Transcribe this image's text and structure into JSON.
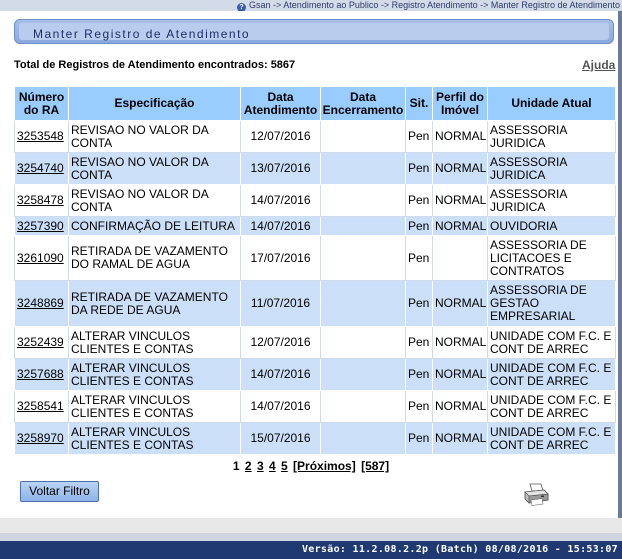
{
  "breadcrumb": "Gsan -> Atendimento ao Publico -> Registro Atendimento -> Manter Registro de Atendimento",
  "page_title": "Manter Registro de Atendimento",
  "total_label": "Total de Registros de Atendimento encontrados: 5867",
  "help_label": "Ajuda",
  "table": {
    "headers": {
      "numero": "Número do RA",
      "especificacao": "Especificação",
      "data_atendimento": "Data Atendimento",
      "data_encerramento": "Data Encerramento",
      "sit": "Sit.",
      "perfil": "Perfil do Imóvel",
      "unidade": "Unidade Atual"
    },
    "rows": [
      {
        "numero": "3253548",
        "especificacao": "REVISAO NO VALOR DA CONTA",
        "data_atendimento": "12/07/2016",
        "data_encerramento": "",
        "sit": "Pen",
        "perfil": "NORMAL",
        "unidade": "ASSESSORIA JURIDICA"
      },
      {
        "numero": "3254740",
        "especificacao": "REVISAO NO VALOR DA CONTA",
        "data_atendimento": "13/07/2016",
        "data_encerramento": "",
        "sit": "Pen",
        "perfil": "NORMAL",
        "unidade": "ASSESSORIA JURIDICA"
      },
      {
        "numero": "3258478",
        "especificacao": "REVISAO NO VALOR DA CONTA",
        "data_atendimento": "14/07/2016",
        "data_encerramento": "",
        "sit": "Pen",
        "perfil": "NORMAL",
        "unidade": "ASSESSORIA JURIDICA"
      },
      {
        "numero": "3257390",
        "especificacao": "CONFIRMAÇÃO DE LEITURA",
        "data_atendimento": "14/07/2016",
        "data_encerramento": "",
        "sit": "Pen",
        "perfil": "NORMAL",
        "unidade": "OUVIDORIA"
      },
      {
        "numero": "3261090",
        "especificacao": "RETIRADA DE VAZAMENTO DO RAMAL DE AGUA",
        "data_atendimento": "17/07/2016",
        "data_encerramento": "",
        "sit": "Pen",
        "perfil": "",
        "unidade": "ASSESSORIA DE LICITACOES E CONTRATOS"
      },
      {
        "numero": "3248869",
        "especificacao": "RETIRADA DE VAZAMENTO DA REDE DE AGUA",
        "data_atendimento": "11/07/2016",
        "data_encerramento": "",
        "sit": "Pen",
        "perfil": "NORMAL",
        "unidade": "ASSESSORIA DE GESTAO EMPRESARIAL"
      },
      {
        "numero": "3252439",
        "especificacao": "ALTERAR VINCULOS CLIENTES E CONTAS",
        "data_atendimento": "12/07/2016",
        "data_encerramento": "",
        "sit": "Pen",
        "perfil": "NORMAL",
        "unidade": "UNIDADE COM F.C. E CONT DE ARREC"
      },
      {
        "numero": "3257688",
        "especificacao": "ALTERAR VINCULOS CLIENTES E CONTAS",
        "data_atendimento": "14/07/2016",
        "data_encerramento": "",
        "sit": "Pen",
        "perfil": "NORMAL",
        "unidade": "UNIDADE COM F.C. E CONT DE ARREC"
      },
      {
        "numero": "3258541",
        "especificacao": "ALTERAR VINCULOS CLIENTES E CONTAS",
        "data_atendimento": "14/07/2016",
        "data_encerramento": "",
        "sit": "Pen",
        "perfil": "NORMAL",
        "unidade": "UNIDADE COM F.C. E CONT DE ARREC"
      },
      {
        "numero": "3258970",
        "especificacao": "ALTERAR VINCULOS CLIENTES E CONTAS",
        "data_atendimento": "15/07/2016",
        "data_encerramento": "",
        "sit": "Pen",
        "perfil": "NORMAL",
        "unidade": "UNIDADE COM F.C. E CONT DE ARREC"
      }
    ]
  },
  "pager": {
    "current": "1",
    "pages": [
      "2",
      "3",
      "4",
      "5"
    ],
    "next_label": "[Próximos]",
    "last_label": "[587]"
  },
  "reset_button_label": "Voltar Filtro",
  "version": "Versão: 11.2.08.2.2p (Batch) 08/08/2016 - 15:53:07",
  "colors": {
    "header_bg": "#99ccff",
    "row_alt_bg": "#cbe0f8",
    "footer_bg": "#1f3a73"
  }
}
